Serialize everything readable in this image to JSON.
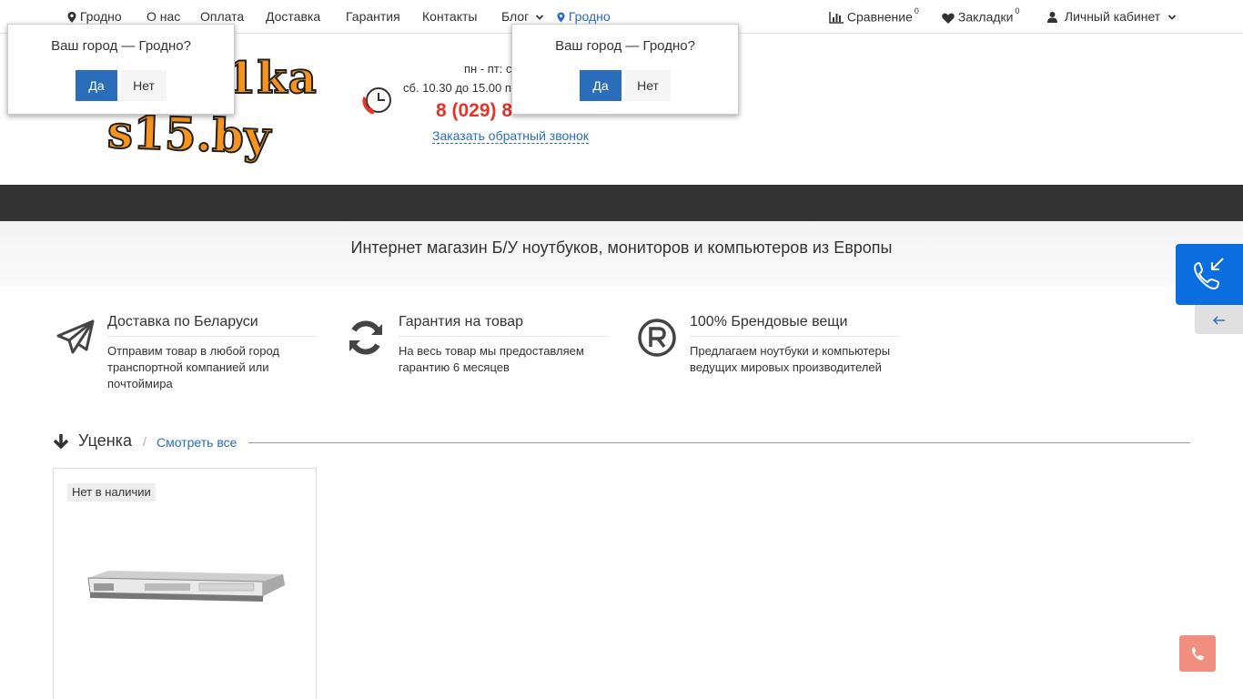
{
  "topnav": {
    "city": "Гродно",
    "links": [
      "О нас",
      "Оплата",
      "Доставка",
      "Гарантия",
      "Контакты",
      "Блог"
    ],
    "city_link": "Гродно",
    "compare_label": "Сравнение",
    "compare_count": "0",
    "bookmarks_label": "Закладки",
    "bookmarks_count": "0",
    "account_label": "Личный кабинет"
  },
  "header": {
    "logo_line1": "1ka",
    "logo_line2": "s15.by",
    "hours_weekday": "пн - пт: с",
    "hours_saturday": "сб. 10.30 до 15.00 п",
    "phone": "8 (029) 8",
    "callback_label": "Заказать обратный звонок"
  },
  "tagline": "Интернет магазин Б/У ноутбуков, мониторов и компьютеров из Европы",
  "features": [
    {
      "icon": "paper-plane-icon",
      "title": "Доставка по Беларуси",
      "text": "Отправим товар в любой город транспортной компанией или почтоймира"
    },
    {
      "icon": "refresh-icon",
      "title": "Гарантия на товар",
      "text": "На весь товар мы предоставляем гарантию 6 месяцев"
    },
    {
      "icon": "registered-icon",
      "title": "100% Брендовые вещи",
      "text": "Предлагаем ноутбуки и компьютеры ведущих мировых производителей"
    }
  ],
  "section": {
    "title": "Уценка",
    "separator": "/",
    "view_all": "Смотреть все"
  },
  "product": {
    "badge": "Нет в наличии"
  },
  "city_popup": {
    "question": "Ваш город — Гродно?",
    "yes": "Да",
    "no": "Нет"
  },
  "colors": {
    "accent_blue": "#2a6dbb",
    "phone_red": "#e3342a",
    "logo_orange": "#f7931e",
    "menubar": "#333333",
    "call_widget": "#0a6de0"
  }
}
